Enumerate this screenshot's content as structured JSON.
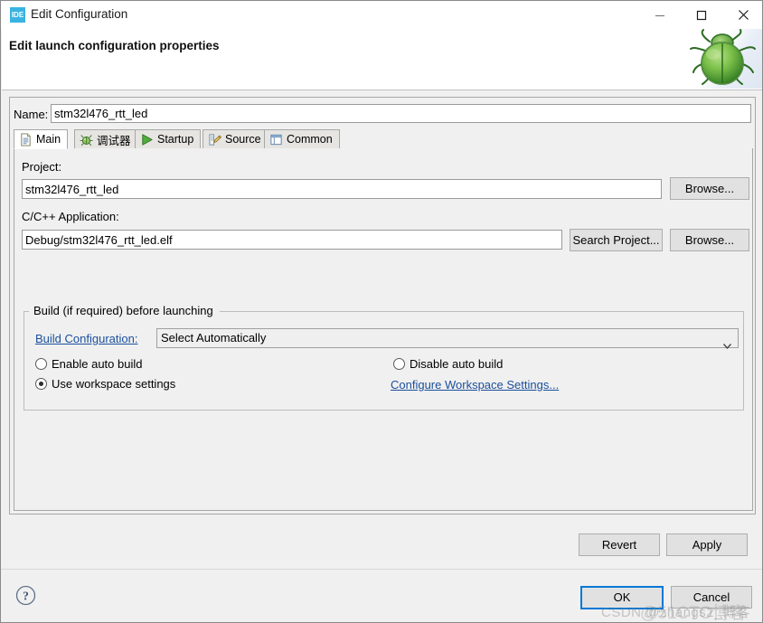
{
  "window": {
    "title": "Edit Configuration",
    "icon_label": "IDE",
    "minimize_label": "Minimize",
    "maximize_label": "Maximize",
    "close_label": "Close"
  },
  "banner": {
    "title": "Edit launch configuration properties",
    "decoration_icon": "green-bug-icon"
  },
  "name_field": {
    "label": "Name:",
    "value": "stm32l476_rtt_led",
    "placeholder": ""
  },
  "tabs": [
    {
      "label": "Main",
      "icon": "document-icon",
      "selected": true
    },
    {
      "label": "调试器",
      "icon": "debugger-icon",
      "selected": false
    },
    {
      "label": "Startup",
      "icon": "run-play-icon",
      "selected": false
    },
    {
      "label": "Source",
      "icon": "source-edit-icon",
      "selected": false
    },
    {
      "label": "Common",
      "icon": "common-window-icon",
      "selected": false
    }
  ],
  "main_tab": {
    "project": {
      "label": "Project:",
      "value": "stm32l476_rtt_led",
      "browse_label": "Browse..."
    },
    "application": {
      "label": "C/C++ Application:",
      "value": "Debug/stm32l476_rtt_led.elf",
      "search_label": "Search Project...",
      "browse_label": "Browse..."
    },
    "build_group": {
      "legend": "Build (if required) before launching",
      "build_config_link": "Build Configuration:",
      "build_config_value": "Select Automatically",
      "build_config_options": [
        "Select Automatically"
      ],
      "radio_enable_auto_build": {
        "label": "Enable auto build",
        "selected": false
      },
      "radio_disable_auto_build": {
        "label": "Disable auto build",
        "selected": false
      },
      "radio_use_workspace_settings": {
        "label": "Use workspace settings",
        "selected": true
      },
      "configure_workspace_link": "Configure Workspace Settings..."
    }
  },
  "footer": {
    "revert_label": "Revert",
    "apply_label": "Apply",
    "ok_label": "OK",
    "cancel_label": "Cancel",
    "help_icon": "question-mark-help-icon"
  },
  "watermark": {
    "text_left": "CSDN @zhangs2_博客",
    "text_right": "@51CTO博客"
  },
  "colors": {
    "accent": "#0078d7",
    "link": "#1b4f9c",
    "icon_badge": "#3ab3e2",
    "dialog_bg": "#f0f0f0"
  }
}
